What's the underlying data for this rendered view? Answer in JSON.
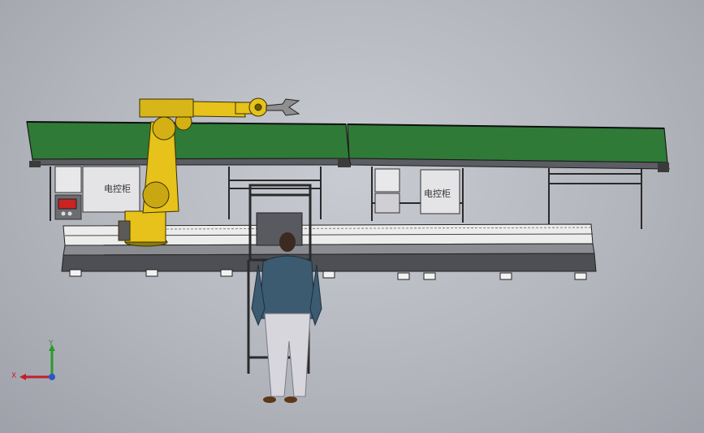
{
  "scene": {
    "cabinet_labels": [
      "电控柜",
      "电控柜"
    ]
  },
  "triad": {
    "x_label": "X",
    "y_label": "Y"
  },
  "colors": {
    "background": "#b9bbc3",
    "conveyor_belt": "#2f7a37",
    "robot": "#e6c21a",
    "frame": "#2a2a2a"
  }
}
